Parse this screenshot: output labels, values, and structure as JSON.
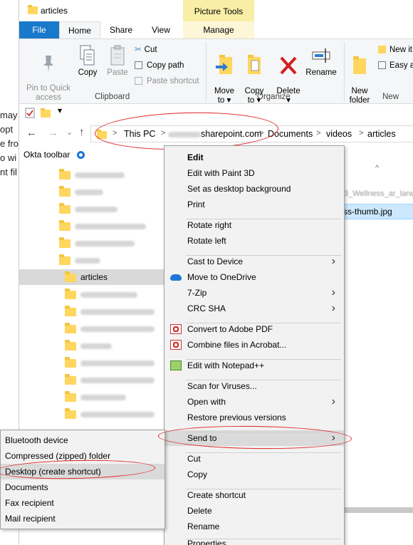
{
  "window": {
    "title": "articles",
    "picture_tools": "Picture Tools"
  },
  "tabs": [
    "File",
    "Home",
    "Share",
    "View",
    "Manage"
  ],
  "ribbon": {
    "pin": "Pin to Quick\naccess",
    "copy": "Copy",
    "paste": "Paste",
    "cut": "Cut",
    "copy_path": "Copy path",
    "paste_shortcut": "Paste shortcut",
    "clipboard": "Clipboard",
    "move_to": "Move\nto ▾",
    "copy_to": "Copy\nto ▾",
    "delete": "Delete\n▾",
    "rename": "Rename",
    "organize": "Organize",
    "new_folder": "New\nfolder",
    "new_item": "New it",
    "easy_access": "Easy a",
    "new": "New"
  },
  "address": {
    "crumbs": [
      "This PC",
      "sharepoint.com",
      "Documents",
      "videos",
      "articles"
    ]
  },
  "left_text": [
    "may",
    "opt",
    "e fro",
    "o wi",
    "nt fil"
  ],
  "okta": "Okta toolbar",
  "tree": {
    "selected": "articles"
  },
  "right_pane": {
    "file": "ss-thumb.jpg",
    "file_blur": "3_Wellness_ar_larw"
  },
  "context_menu": [
    {
      "label": "Edit",
      "bold": true
    },
    {
      "label": "Edit with Paint 3D"
    },
    {
      "label": "Set as desktop background"
    },
    {
      "label": "Print"
    },
    {
      "label": "Rotate right"
    },
    {
      "label": "Rotate left"
    },
    {
      "label": "Cast to Device"
    },
    {
      "label": "Move to OneDrive"
    },
    {
      "label": "7-Zip"
    },
    {
      "label": "CRC SHA"
    },
    {
      "label": "Convert to Adobe PDF"
    },
    {
      "label": "Combine files in Acrobat..."
    },
    {
      "label": "Edit with Notepad++"
    },
    {
      "label": "Scan for Viruses..."
    },
    {
      "label": "Open with"
    },
    {
      "label": "Restore previous versions"
    },
    {
      "label": "Send to"
    },
    {
      "label": "Cut"
    },
    {
      "label": "Copy"
    },
    {
      "label": "Create shortcut"
    },
    {
      "label": "Delete"
    },
    {
      "label": "Rename"
    },
    {
      "label": "Properties"
    }
  ],
  "send_to_menu": [
    {
      "label": "Bluetooth device"
    },
    {
      "label": "Compressed (zipped) folder"
    },
    {
      "label": "Desktop (create shortcut)"
    },
    {
      "label": "Documents"
    },
    {
      "label": "Fax recipient"
    },
    {
      "label": "Mail recipient"
    }
  ]
}
